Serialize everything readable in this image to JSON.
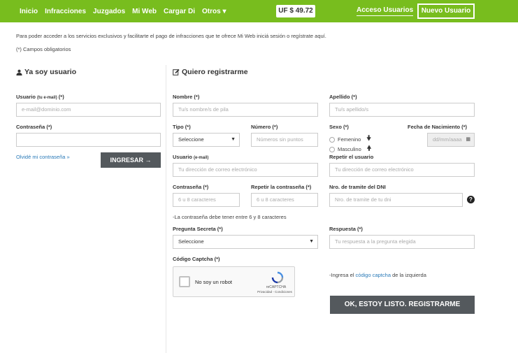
{
  "nav": {
    "items": [
      "Inicio",
      "Infracciones",
      "Juzgados",
      "Mi Web",
      "Cargar Di",
      "Otros ▾"
    ],
    "uf": "UF $ 49.72",
    "acceso": "Acceso Usuarios",
    "nuevo": "Nuevo Usuario"
  },
  "intro": {
    "text": "Para poder acceder a los servicios exclusivos y facilitarte el pago de infracciones que te ofrece Mi Web iniciá sesión o regístrate aquí.",
    "required": "(*) Campos obligatorios"
  },
  "login": {
    "heading": "Ya soy usuario",
    "usuario_label": "Usuario",
    "usuario_sub": "(tu e-mail)",
    "usuario_req": "(*)",
    "usuario_placeholder": "e-mail@dominio.com",
    "password_label": "Contraseña (*)",
    "forgot": "Olvidé mi contraseña »",
    "submit": "INGRESAR →"
  },
  "register": {
    "heading": "Quiero registrarme",
    "nombre_label": "Nombre (*)",
    "nombre_placeholder": "Tu/s nombre/s de pila",
    "apellido_label": "Apellido (*)",
    "apellido_placeholder": "Tu/s apellido/s",
    "tipo_label": "Tipo (*)",
    "tipo_value": "Seleccione",
    "numero_label": "Número (*)",
    "numero_placeholder": "Números sin puntos",
    "sexo_label": "Sexo (*)",
    "sexo_femenino": "Femenino",
    "sexo_masculino": "Masculino",
    "fecha_label": "Fecha de Nacimiento (*)",
    "fecha_placeholder": "dd/mm/aaaa",
    "usuario_label": "Usuario",
    "usuario_sub": "(e-mail)",
    "usuario_placeholder": "Tu dirección de correo electrónico",
    "repetir_usuario_label": "Repetir el usuario",
    "repetir_usuario_placeholder": "Tu dirección de correo electrónico",
    "password_label": "Contraseña (*)",
    "password_placeholder": "6 u 8 caracteres",
    "repetir_password_label": "Repetir la contraseña (*)",
    "repetir_password_placeholder": "6 u 8 caracteres",
    "tramite_label": "Nro. de tramite del DNI",
    "tramite_placeholder": "Nro. de tramite de tu dni",
    "password_hint": "-La contraseña debe tener entre 6 y 8 caracteres",
    "pregunta_label": "Pregunta Secreta (*)",
    "pregunta_value": "Seleccione",
    "respuesta_label": "Respuesta (*)",
    "respuesta_placeholder": "Tu respuesta a la pregunta elegida",
    "captcha_label": "Código Captcha (*)",
    "captcha_text": "No soy un robot",
    "captcha_brand": "reCAPTCHA",
    "captcha_terms": "Privacidad - Condiciones",
    "captcha_hint_prefix": "-Ingresa el",
    "captcha_hint_link": "código captcha",
    "captcha_hint_suffix": "de la izquierda",
    "submit": "OK, ESTOY LISTO. REGISTRARME"
  }
}
